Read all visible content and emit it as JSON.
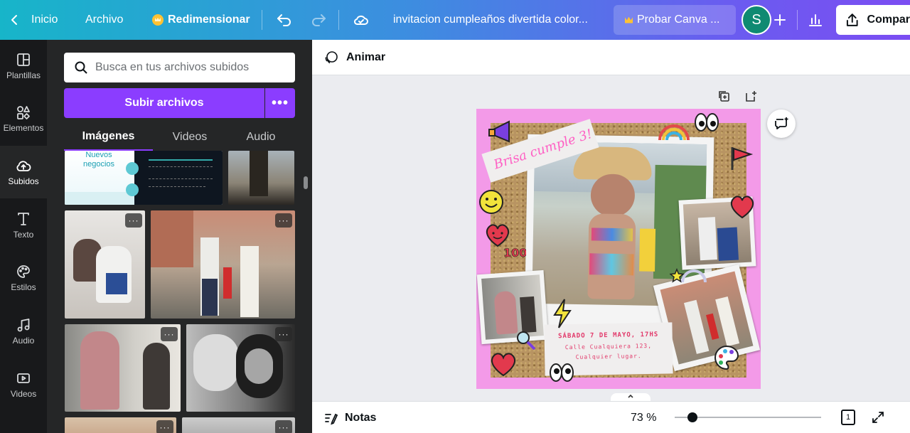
{
  "topbar": {
    "back_label": "Inicio",
    "file_label": "Archivo",
    "resize_label": "Redimensionar",
    "doc_title": "invitacion cumpleaños divertida color...",
    "try_pro_label": "Probar Canva ...",
    "avatar_initial": "S",
    "share_label": "Compartir"
  },
  "rail": {
    "items": [
      {
        "label": "Plantillas",
        "icon": "layout-icon"
      },
      {
        "label": "Elementos",
        "icon": "shapes-icon"
      },
      {
        "label": "Subidos",
        "icon": "cloud-upload-icon"
      },
      {
        "label": "Texto",
        "icon": "text-icon"
      },
      {
        "label": "Estilos",
        "icon": "palette-icon"
      },
      {
        "label": "Audio",
        "icon": "music-note-icon"
      },
      {
        "label": "Videos",
        "icon": "video-icon"
      }
    ]
  },
  "panel": {
    "search_placeholder": "Busca en tus archivos subidos",
    "upload_label": "Subir archivos",
    "more_label": "•••",
    "tabs": [
      "Imágenes",
      "Videos",
      "Audio"
    ],
    "slide_text": "Nuevos negocios",
    "thumb_more": "···"
  },
  "editor": {
    "animate_label": "Animar",
    "design": {
      "banner": "Brisa cumple 3!",
      "event_line1": "SÁBADO 7 DE MAYO, 17HS",
      "event_line2": "Calle Cualquiera 123,",
      "event_line3": "Cualquier lugar."
    }
  },
  "bottombar": {
    "notes_label": "Notas",
    "zoom_label": "73 %",
    "zoom_fraction": 0.12,
    "page_count": "1"
  },
  "colors": {
    "accent_purple": "#8b3dff",
    "design_pink": "#f39ae8",
    "sidebar_dark": "#18191b"
  }
}
